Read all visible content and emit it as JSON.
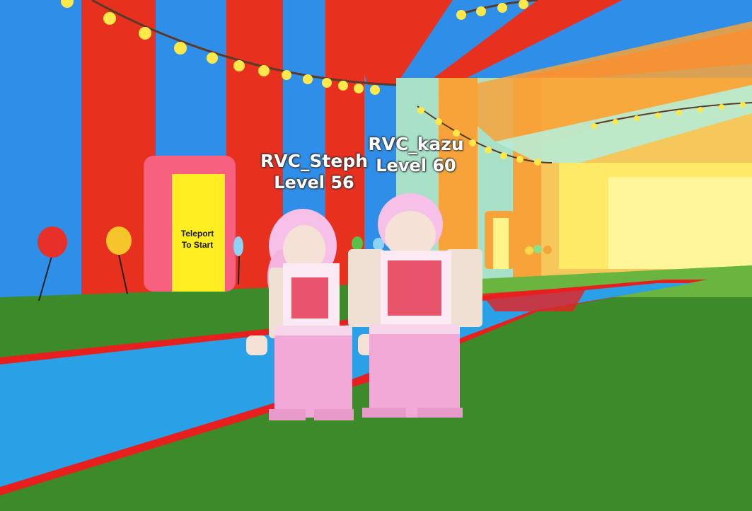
{
  "players": [
    {
      "name": "RVC_Steph",
      "level": "Level 56"
    },
    {
      "name": "RVC_kazu",
      "level": "Level 60"
    }
  ],
  "door": {
    "line1": "Teleport",
    "line2": "To Start"
  },
  "colors": {
    "tent_red": "#e8301f",
    "tent_blue": "#2f8ee8",
    "grass": "#3d8a2a",
    "path_blue": "#2aa0e6",
    "path_border": "#e81f1f",
    "door_frame": "#f7607f",
    "door_inner": "#ffee22",
    "avatar_pink": "#f2a9d8"
  }
}
